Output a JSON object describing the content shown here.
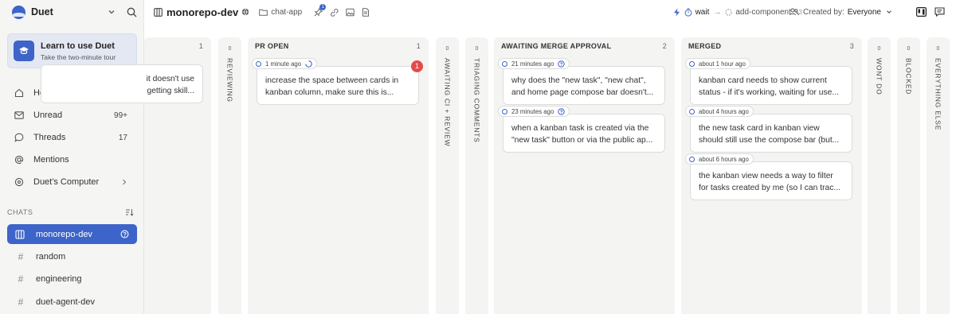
{
  "app": {
    "name": "Duet"
  },
  "promo": {
    "title": "Learn to use Duet",
    "subtitle": "Take the two-minute tour"
  },
  "nav": [
    {
      "label": "Home",
      "icon": "home-icon",
      "count": ""
    },
    {
      "label": "Unread",
      "icon": "mail-icon",
      "count": "99+"
    },
    {
      "label": "Threads",
      "icon": "chat-bubble-icon",
      "count": "17"
    },
    {
      "label": "Mentions",
      "icon": "at-icon",
      "count": ""
    },
    {
      "label": "Duet's Computer",
      "icon": "computer-icon",
      "count": ""
    }
  ],
  "chats": {
    "header": "CHATS",
    "items": [
      {
        "label": "monorepo-dev",
        "active": true
      },
      {
        "label": "random"
      },
      {
        "label": "engineering"
      },
      {
        "label": "duet-agent-dev"
      }
    ]
  },
  "topbar": {
    "repo_title": "monorepo-dev",
    "breadcrumb": "chat-app",
    "pin_badge": "1",
    "status_wait": "wait",
    "status_next": "add-component",
    "status_more": "+3",
    "created_by_label": "Created by:",
    "created_by_value": "Everyone"
  },
  "board": {
    "columns": [
      {
        "title": "",
        "count": "1",
        "cards": [
          {
            "lines": [
              "it doesn't use",
              "getting skill..."
            ]
          }
        ]
      },
      {
        "title": "PR OPEN",
        "count": "1",
        "cards": [
          {
            "time": "1 minute ago",
            "lines": [
              "increase the space between cards in",
              "kanban column, make sure this is..."
            ],
            "badge": "1"
          }
        ]
      },
      {
        "title": "AWAITING MERGE APPROVAL",
        "count": "2",
        "cards": [
          {
            "time": "21 minutes ago",
            "lines": [
              "why does the \"new task\", \"new chat\",",
              "and home page compose bar doesn't..."
            ]
          },
          {
            "time": "23 minutes ago",
            "lines": [
              "when a kanban task is created via the",
              "\"new task\" button or via the public ap..."
            ]
          }
        ]
      },
      {
        "title": "MERGED",
        "count": "3",
        "cards": [
          {
            "time": "about 1 hour ago",
            "lines": [
              "kanban card needs to show current",
              "status - if it's working, waiting for use..."
            ]
          },
          {
            "time": "about 4 hours ago",
            "lines": [
              "the new task card in kanban view",
              "should still use the compose bar (but..."
            ]
          },
          {
            "time": "about 6 hours ago",
            "lines": [
              "the kanban view needs a way to filter",
              "for tasks created by me (so I can trac..."
            ]
          }
        ]
      }
    ],
    "collapsed": [
      {
        "title": "REVIEWING",
        "count": "0"
      },
      {
        "title": "AWAITING CI + REVIEW",
        "count": "0"
      },
      {
        "title": "TRIAGING COMMENTS",
        "count": "0"
      },
      {
        "title": "WONT DO",
        "count": "0"
      },
      {
        "title": "BLOCKED",
        "count": "0"
      },
      {
        "title": "EVERYTHING ELSE",
        "count": "0"
      }
    ]
  }
}
